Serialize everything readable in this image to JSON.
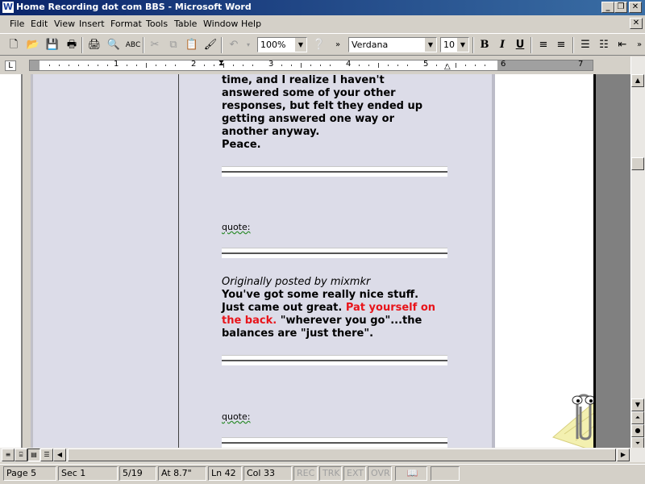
{
  "window": {
    "title": "Home Recording dot com BBS - Microsoft Word",
    "app_icon": "W",
    "controls": {
      "minimize": "_",
      "restore": "❐",
      "close": "✕"
    },
    "doc_close": "✕"
  },
  "menu": [
    "File",
    "Edit",
    "View",
    "Insert",
    "Format",
    "Tools",
    "Table",
    "Window",
    "Help"
  ],
  "toolbar": {
    "zoom": "100%",
    "font": "Verdana",
    "size": "10",
    "bold": "B",
    "italic": "I",
    "underline": "U",
    "overflow": "»"
  },
  "ruler": {
    "marks": [
      "1",
      "2",
      "3",
      "4",
      "5",
      "6",
      "7"
    ]
  },
  "document": {
    "top_lines": [
      "time, and I realize I haven't",
      "answered some of your other",
      "responses, but felt they ended up",
      "getting answered one way or",
      "another anyway.",
      "Peace."
    ],
    "quote_label": "quote:",
    "quote2_label": "quote:",
    "attribution": "Originally posted by mixmkr",
    "q_line1": "You've got some really nice stuff.",
    "q_line2_a": "Just came out great. ",
    "q_line2_b": "Pat yourself on",
    "q_line3_a": "the back.",
    "q_line3_b": " \"wherever you go\"...the",
    "q_line4": "balances are \"just there\".",
    "highlight_color": "#e8141a"
  },
  "status": {
    "page": "Page 5",
    "section": "Sec 1",
    "pages": "5/19",
    "at": "At 8.7\"",
    "line": "Ln 42",
    "col": "Col 33",
    "rec": "REC",
    "trk": "TRK",
    "ext": "EXT",
    "ovr": "OVR"
  }
}
